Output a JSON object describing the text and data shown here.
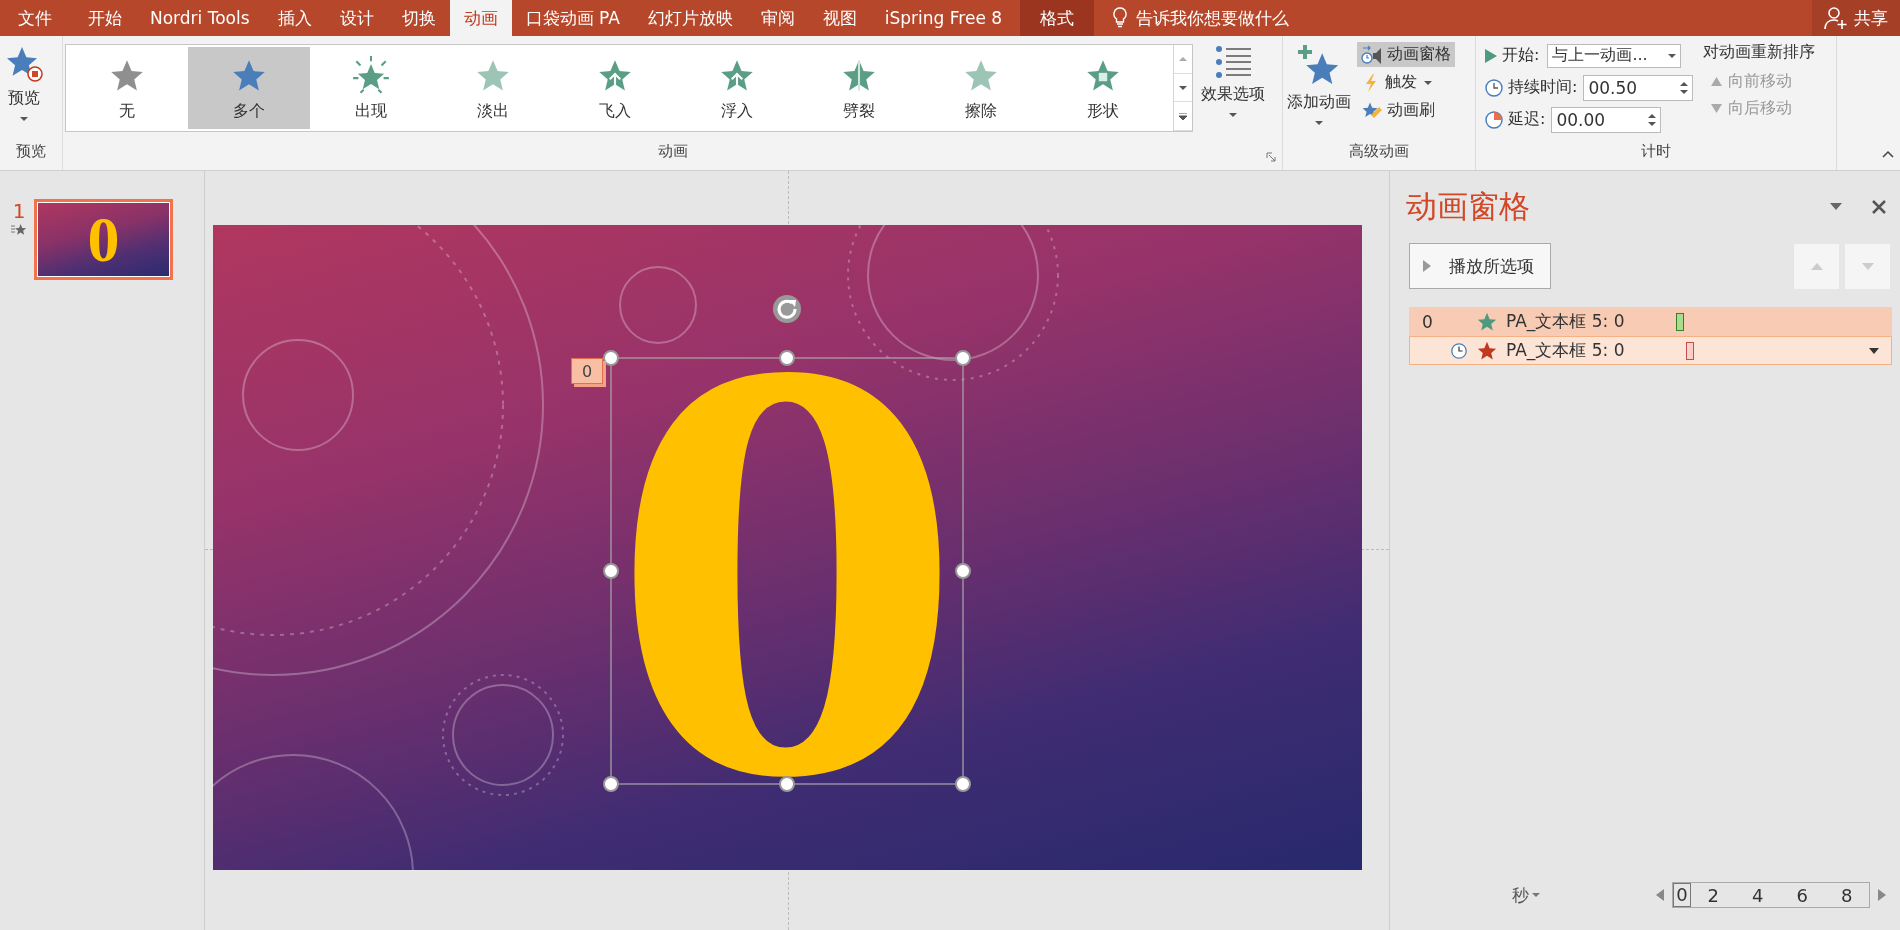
{
  "tabs": [
    {
      "label": "文件",
      "selected": false,
      "contextual": false
    },
    {
      "label": "开始",
      "selected": false,
      "contextual": false
    },
    {
      "label": "Nordri Tools",
      "selected": false,
      "contextual": false
    },
    {
      "label": "插入",
      "selected": false,
      "contextual": false
    },
    {
      "label": "设计",
      "selected": false,
      "contextual": false
    },
    {
      "label": "切换",
      "selected": false,
      "contextual": false
    },
    {
      "label": "动画",
      "selected": true,
      "contextual": false
    },
    {
      "label": "口袋动画 PA",
      "selected": false,
      "contextual": false
    },
    {
      "label": "幻灯片放映",
      "selected": false,
      "contextual": false
    },
    {
      "label": "审阅",
      "selected": false,
      "contextual": false
    },
    {
      "label": "视图",
      "selected": false,
      "contextual": false
    },
    {
      "label": "iSpring Free 8",
      "selected": false,
      "contextual": false
    },
    {
      "label": "格式",
      "selected": false,
      "contextual": true
    }
  ],
  "tell_me": {
    "placeholder": "告诉我你想要做什么"
  },
  "share": {
    "label": "共享"
  },
  "preview_group": {
    "button": "预览",
    "label": "预览"
  },
  "animation_group": {
    "label": "动画",
    "effects": [
      {
        "label": "无",
        "kind": "none",
        "selected": false
      },
      {
        "label": "多个",
        "kind": "multiple",
        "selected": true
      },
      {
        "label": "出现",
        "kind": "appear",
        "selected": false
      },
      {
        "label": "淡出",
        "kind": "fade",
        "selected": false
      },
      {
        "label": "飞入",
        "kind": "fly-in",
        "selected": false
      },
      {
        "label": "浮入",
        "kind": "float-in",
        "selected": false
      },
      {
        "label": "劈裂",
        "kind": "split",
        "selected": false
      },
      {
        "label": "擦除",
        "kind": "wipe",
        "selected": false
      },
      {
        "label": "形状",
        "kind": "shape",
        "selected": false
      }
    ],
    "effect_options": "效果选项"
  },
  "advanced_group": {
    "label": "高级动画",
    "add_animation": "添加动画",
    "commands": [
      {
        "label": "动画窗格",
        "kind": "pane",
        "on": true,
        "dropdown": false
      },
      {
        "label": "触发",
        "kind": "trigger",
        "on": false,
        "dropdown": true
      },
      {
        "label": "动画刷",
        "kind": "painter",
        "on": false,
        "dropdown": false
      }
    ]
  },
  "timing_group": {
    "label": "计时",
    "start": {
      "label": "开始:",
      "value": "与上一动画..."
    },
    "duration": {
      "label": "持续时间:",
      "value": "00.50"
    },
    "delay": {
      "label": "延迟:",
      "value": "00.00"
    },
    "reorder": {
      "title": "对动画重新排序",
      "buttons": [
        {
          "label": "向前移动",
          "kind": "up",
          "disabled": true
        },
        {
          "label": "向后移动",
          "kind": "down",
          "disabled": true
        }
      ]
    }
  },
  "thumbnails": [
    {
      "number": "1",
      "text": "0",
      "selected": true,
      "has_animation": true
    }
  ],
  "slide": {
    "text": "0",
    "animation_tag": "0"
  },
  "animation_pane": {
    "title": "动画窗格",
    "play_button": "播放所选项",
    "items": [
      {
        "index": "0",
        "after_previous": false,
        "kind": "entrance",
        "label": "PA_文本框 5: 0",
        "selected": true,
        "dropdown": false
      },
      {
        "after_previous": true,
        "kind": "exit",
        "label": "PA_文本框 5: 0",
        "selected": false,
        "dropdown": true
      }
    ],
    "time_unit": "秒",
    "timeline_ticks": [
      "0",
      "2",
      "4",
      "6",
      "8"
    ]
  }
}
